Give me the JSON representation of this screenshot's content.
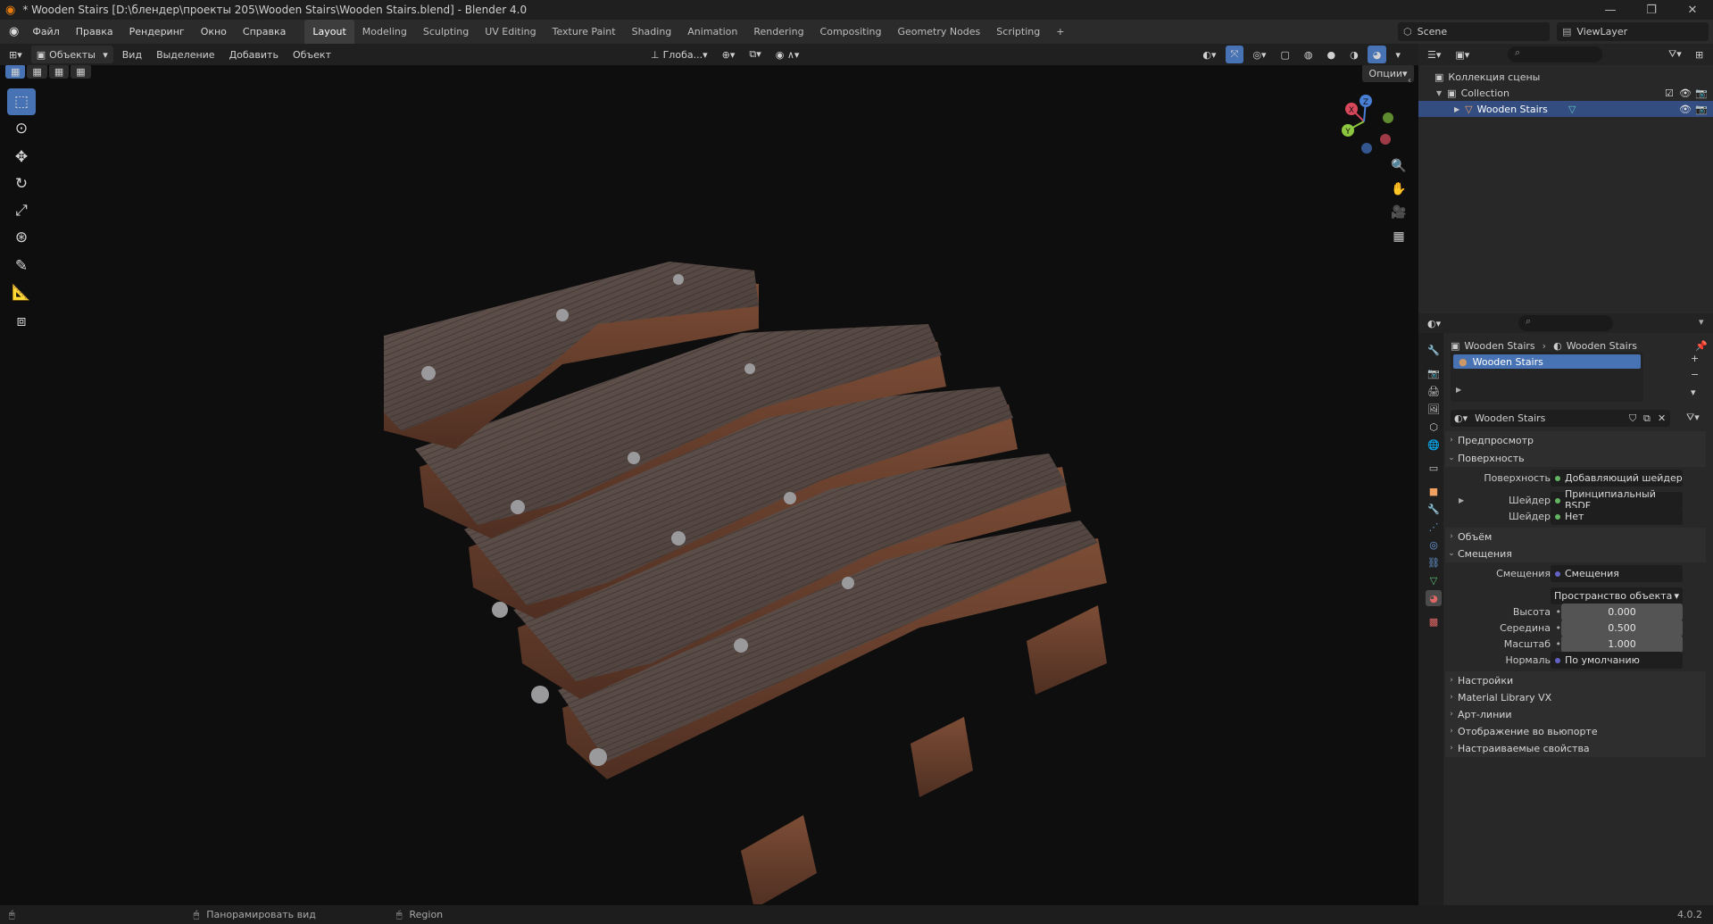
{
  "window": {
    "title": "* Wooden Stairs [D:\\блендер\\проекты 205\\Wooden Stairs\\Wooden Stairs.blend] - Blender 4.0"
  },
  "menus": [
    "Файл",
    "Правка",
    "Рендеринг",
    "Окно",
    "Справка"
  ],
  "workspaces": [
    "Layout",
    "Modeling",
    "Sculpting",
    "UV Editing",
    "Texture Paint",
    "Shading",
    "Animation",
    "Rendering",
    "Compositing",
    "Geometry Nodes",
    "Scripting"
  ],
  "scene": {
    "name": "Scene",
    "viewlayer": "ViewLayer"
  },
  "viewport_header": {
    "mode": "Объекты",
    "view": "Вид",
    "select": "Выделение",
    "add": "Добавить",
    "object": "Объект",
    "orientation": "Глоба...",
    "options": "Опции"
  },
  "outliner": {
    "root": "Коллекция сцены",
    "collection": "Collection",
    "object": "Wooden Stairs"
  },
  "properties": {
    "breadcrumb_object": "Wooden Stairs",
    "breadcrumb_material": "Wooden Stairs",
    "slot": "Wooden Stairs",
    "material_name": "Wooden Stairs",
    "preview": "Предпросмотр",
    "surface_section": "Поверхность",
    "surface_label": "Поверхность",
    "surface_value": "Добавляющий шейдер",
    "shader1_label": "Шейдер",
    "shader1_value": "Принципиальный BSDF",
    "shader2_label": "Шейдер",
    "shader2_value": "Нет",
    "volume": "Объём",
    "displacement_section": "Смещения",
    "disp_label": "Смещения",
    "disp_value": "Смещения",
    "space_value": "Пространство объекта",
    "height_label": "Высота",
    "height_value": "0.000",
    "mid_label": "Середина",
    "mid_value": "0.500",
    "scale_label": "Масштаб",
    "scale_value": "1.000",
    "normal_label": "Нормаль",
    "normal_value": "По умолчанию",
    "settings": "Настройки",
    "mlvx": "Material Library VX",
    "lineart": "Арт-линии",
    "viewport_display": "Отображение во вьюпорте",
    "custom_props": "Настраиваемые свойства"
  },
  "status": {
    "pan": "Панорамировать вид",
    "region": "Region",
    "version": "4.0.2"
  },
  "gizmo": {
    "x": "X",
    "y": "Y",
    "z": "Z"
  },
  "colors": {
    "accent": "#4772b3",
    "wood_top": "#5a4a44",
    "wood_side": "#6b4330"
  }
}
